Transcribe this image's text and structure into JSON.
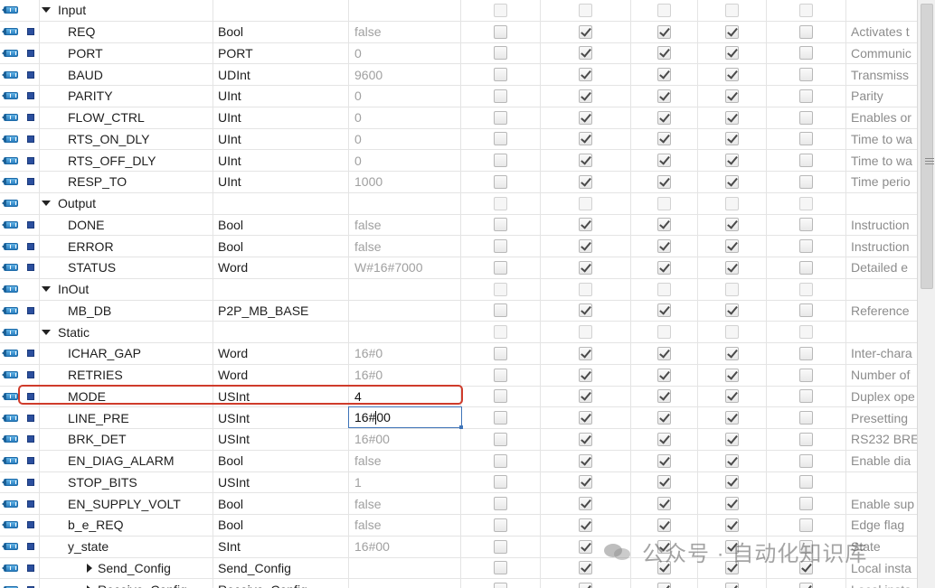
{
  "rows": [
    {
      "kind": "section",
      "name": "Input",
      "type": "",
      "default": "",
      "cbs": [
        0,
        0,
        0,
        0,
        0
      ],
      "comment": ""
    },
    {
      "kind": "child",
      "name": "REQ",
      "type": "Bool",
      "default": "false",
      "cbs": [
        0,
        1,
        1,
        1,
        0
      ],
      "comment": "Activates t"
    },
    {
      "kind": "child",
      "name": "PORT",
      "type": "PORT",
      "default": "0",
      "cbs": [
        0,
        1,
        1,
        1,
        0
      ],
      "comment": "Communic"
    },
    {
      "kind": "child",
      "name": "BAUD",
      "type": "UDInt",
      "default": "9600",
      "cbs": [
        0,
        1,
        1,
        1,
        0
      ],
      "comment": "Transmiss"
    },
    {
      "kind": "child",
      "name": "PARITY",
      "type": "UInt",
      "default": "0",
      "cbs": [
        0,
        1,
        1,
        1,
        0
      ],
      "comment": "Parity"
    },
    {
      "kind": "child",
      "name": "FLOW_CTRL",
      "type": "UInt",
      "default": "0",
      "cbs": [
        0,
        1,
        1,
        1,
        0
      ],
      "comment": "Enables or"
    },
    {
      "kind": "child",
      "name": "RTS_ON_DLY",
      "type": "UInt",
      "default": "0",
      "cbs": [
        0,
        1,
        1,
        1,
        0
      ],
      "comment": "Time to wa"
    },
    {
      "kind": "child",
      "name": "RTS_OFF_DLY",
      "type": "UInt",
      "default": "0",
      "cbs": [
        0,
        1,
        1,
        1,
        0
      ],
      "comment": "Time to wa"
    },
    {
      "kind": "child",
      "name": "RESP_TO",
      "type": "UInt",
      "default": "1000",
      "cbs": [
        0,
        1,
        1,
        1,
        0
      ],
      "comment": "Time perio"
    },
    {
      "kind": "section",
      "name": "Output",
      "type": "",
      "default": "",
      "cbs": [
        0,
        0,
        0,
        0,
        0
      ],
      "comment": ""
    },
    {
      "kind": "child",
      "name": "DONE",
      "type": "Bool",
      "default": "false",
      "cbs": [
        0,
        1,
        1,
        1,
        0
      ],
      "comment": "Instruction"
    },
    {
      "kind": "child",
      "name": "ERROR",
      "type": "Bool",
      "default": "false",
      "cbs": [
        0,
        1,
        1,
        1,
        0
      ],
      "comment": "Instruction"
    },
    {
      "kind": "child",
      "name": "STATUS",
      "type": "Word",
      "default": "W#16#7000",
      "cbs": [
        0,
        1,
        1,
        1,
        0
      ],
      "comment": "Detailed e"
    },
    {
      "kind": "section",
      "name": "InOut",
      "type": "",
      "default": "",
      "cbs": [
        0,
        0,
        0,
        0,
        0
      ],
      "comment": ""
    },
    {
      "kind": "child",
      "name": "MB_DB",
      "type": "P2P_MB_BASE",
      "default": "",
      "cbs": [
        0,
        1,
        1,
        1,
        0
      ],
      "comment": "Reference"
    },
    {
      "kind": "section",
      "name": "Static",
      "type": "",
      "default": "",
      "cbs": [
        0,
        0,
        0,
        0,
        0
      ],
      "comment": ""
    },
    {
      "kind": "child",
      "name": "ICHAR_GAP",
      "type": "Word",
      "default": "16#0",
      "cbs": [
        0,
        1,
        1,
        1,
        0
      ],
      "comment": "Inter-chara"
    },
    {
      "kind": "child",
      "name": "RETRIES",
      "type": "Word",
      "default": "16#0",
      "cbs": [
        0,
        1,
        1,
        1,
        0
      ],
      "comment": "Number of"
    },
    {
      "kind": "child",
      "name": "MODE",
      "type": "USInt",
      "default": "4",
      "cbs": [
        0,
        1,
        1,
        1,
        0
      ],
      "comment": "Duplex ope"
    },
    {
      "kind": "child",
      "name": "LINE_PRE",
      "type": "USInt",
      "default": "",
      "cbs": [
        0,
        1,
        1,
        1,
        0
      ],
      "comment": "Presetting"
    },
    {
      "kind": "child",
      "name": "BRK_DET",
      "type": "USInt",
      "default": "16#00",
      "cbs": [
        0,
        1,
        1,
        1,
        0
      ],
      "comment": "RS232 BRE"
    },
    {
      "kind": "child",
      "name": "EN_DIAG_ALARM",
      "type": "Bool",
      "default": "false",
      "cbs": [
        0,
        1,
        1,
        1,
        0
      ],
      "comment": "Enable dia"
    },
    {
      "kind": "child",
      "name": "STOP_BITS",
      "type": "USInt",
      "default": "1",
      "cbs": [
        0,
        1,
        1,
        1,
        0
      ],
      "comment": ""
    },
    {
      "kind": "child",
      "name": "EN_SUPPLY_VOLT",
      "type": "Bool",
      "default": "false",
      "cbs": [
        0,
        1,
        1,
        1,
        0
      ],
      "comment": "Enable sup"
    },
    {
      "kind": "child",
      "name": "b_e_REQ",
      "type": "Bool",
      "default": "false",
      "cbs": [
        0,
        1,
        1,
        1,
        0
      ],
      "comment": "Edge flag"
    },
    {
      "kind": "child",
      "name": "y_state",
      "type": "SInt",
      "default": "16#00",
      "cbs": [
        0,
        1,
        1,
        1,
        0
      ],
      "comment": "State"
    },
    {
      "kind": "struct",
      "name": "Send_Config",
      "type": "Send_Config",
      "default": "",
      "cbs": [
        0,
        1,
        1,
        1,
        1
      ],
      "comment": "Local insta"
    },
    {
      "kind": "struct",
      "name": "Receive_Config",
      "type": "Receive_Config",
      "default": "",
      "cbs": [
        0,
        1,
        1,
        1,
        1
      ],
      "comment": "Local insta"
    }
  ],
  "editor": {
    "text_before": "16#",
    "text_after": "00"
  },
  "watermark": {
    "text": "公众号 · 自动化知识库"
  }
}
